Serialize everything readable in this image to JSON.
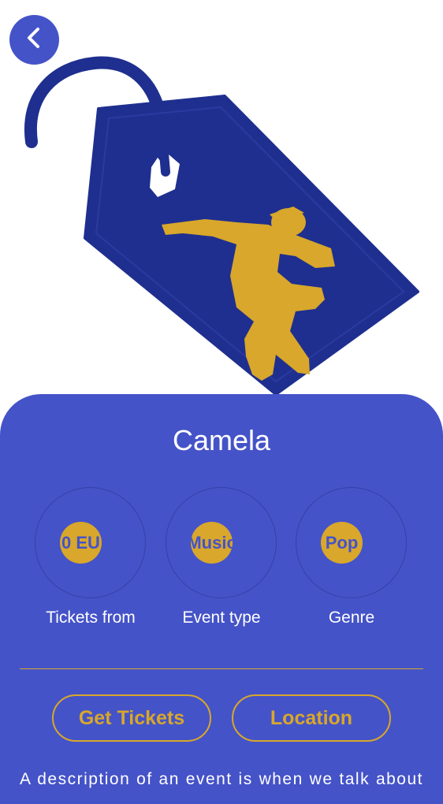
{
  "event": {
    "title": "Camela",
    "stats": [
      {
        "value": "0 EU",
        "label": "Tickets from"
      },
      {
        "value": "Music",
        "label": "Event type"
      },
      {
        "value": "Pop",
        "label": "Genre"
      }
    ],
    "buttons": {
      "tickets": "Get Tickets",
      "location": "Location"
    },
    "description": "A description of an event is when we talk about"
  },
  "theme": {
    "primary": "#4553c8",
    "tag_blue": "#1f2f8f",
    "accent_gold": "#d8a72b",
    "text_white": "#ffffff"
  },
  "icons": {
    "back": "chevron-left-icon",
    "hero": "ticket-tag-with-jumping-dancer"
  }
}
